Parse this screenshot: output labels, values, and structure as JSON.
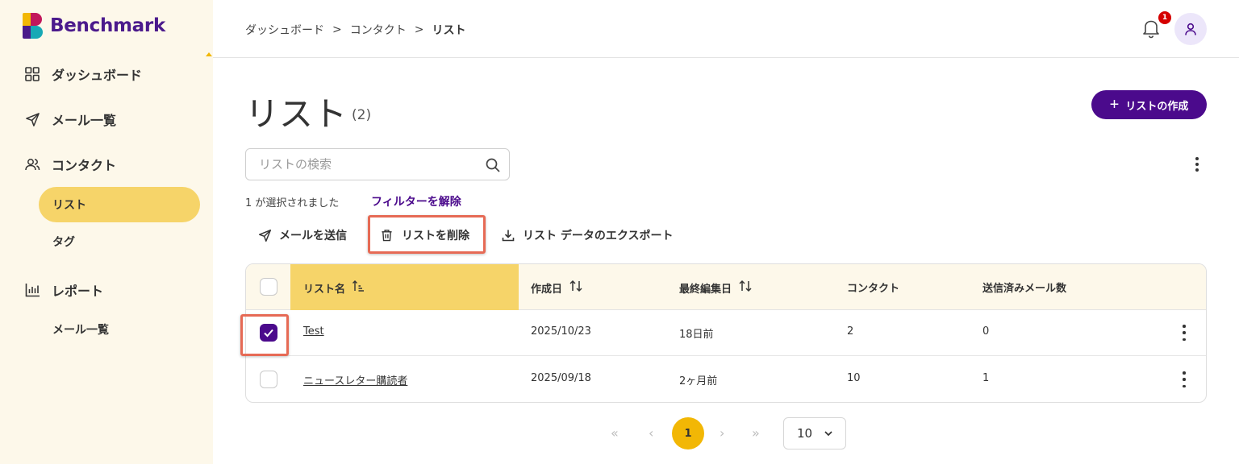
{
  "brand": {
    "name": "Benchmark"
  },
  "sidebar": {
    "items": [
      {
        "label": "ダッシュボード",
        "icon": "grid-icon"
      },
      {
        "label": "メール一覧",
        "icon": "send-icon"
      },
      {
        "label": "コンタクト",
        "icon": "users-icon"
      },
      {
        "label": "レポート",
        "icon": "bar-chart-icon"
      }
    ],
    "contacts_sub": [
      {
        "label": "リスト",
        "active": true
      },
      {
        "label": "タグ",
        "active": false
      }
    ],
    "reports_sub": [
      {
        "label": "メール一覧"
      }
    ]
  },
  "header": {
    "breadcrumb": [
      "ダッシュボード",
      "コンタクト",
      "リスト"
    ],
    "breadcrumb_sep": ">",
    "notification_count": "1"
  },
  "main": {
    "title": "リスト",
    "count": "(2)",
    "create_button": "リストの作成",
    "search_placeholder": "リストの検索",
    "selected_text": "1 が選択されました",
    "clear_filter": "フィルターを解除",
    "actions": {
      "send": "メールを送信",
      "delete": "リストを削除",
      "export": "リスト データのエクスポート"
    }
  },
  "table": {
    "headers": {
      "name": "リスト名",
      "created": "作成日",
      "edited": "最終編集日",
      "contacts": "コンタクト",
      "sent": "送信済みメール数"
    },
    "rows": [
      {
        "name": "Test",
        "created": "2025/10/23",
        "edited": "18日前",
        "contacts": "2",
        "sent": "0",
        "checked": true
      },
      {
        "name": "ニュースレター購読者",
        "created": "2025/09/18",
        "edited": "2ヶ月前",
        "contacts": "10",
        "sent": "1",
        "checked": false
      }
    ]
  },
  "pagination": {
    "first": "«",
    "prev": "‹",
    "current": "1",
    "next": "›",
    "last": "»",
    "page_size": "10"
  },
  "colors": {
    "primary": "#4b0a8c",
    "accent": "#f6d469",
    "sidebar_bg": "#fdf8ea",
    "highlight": "#e66a55",
    "badge": "#d50000"
  }
}
